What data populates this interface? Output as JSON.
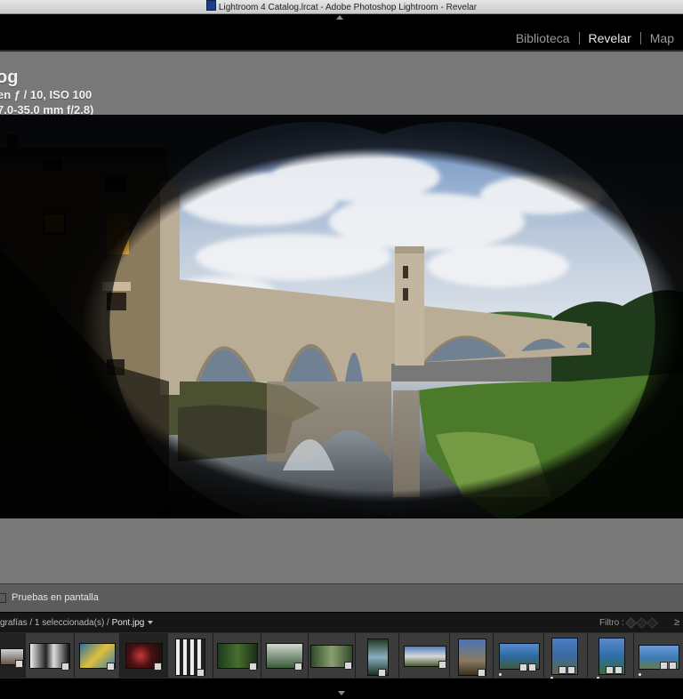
{
  "window": {
    "title": "Lightroom 4 Catalog.lrcat - Adobe Photoshop Lightroom - Revelar"
  },
  "modules": [
    {
      "label": "Biblioteca",
      "active": false
    },
    {
      "label": "Revelar",
      "active": true
    },
    {
      "label": "Map",
      "active": false
    }
  ],
  "photo_info": {
    "name": "og",
    "line2": "en ƒ / 10, ISO 100",
    "line3": "7.0-35.0 mm f/2.8)"
  },
  "toolbar": {
    "soft_proof_label": "Pruebas en pantalla",
    "soft_proof_checked": false
  },
  "filmstrip_bar": {
    "path_prefix": "grafías / 1 seleccionada(s) / ",
    "filename": "Pont.jpg",
    "filter_label": "Filtro :"
  },
  "icons": {
    "title_doc": "lightroom-doc-icon",
    "checkbox": "checkbox-icon",
    "menu": "chevron-down-icon",
    "flags": "flag-filter-icon",
    "collapse": "collapse-arrow-icon"
  },
  "colors": {
    "panel_bg": "#787878",
    "active_module": "#e8e8e8",
    "inactive_module": "#9a9a9a"
  }
}
